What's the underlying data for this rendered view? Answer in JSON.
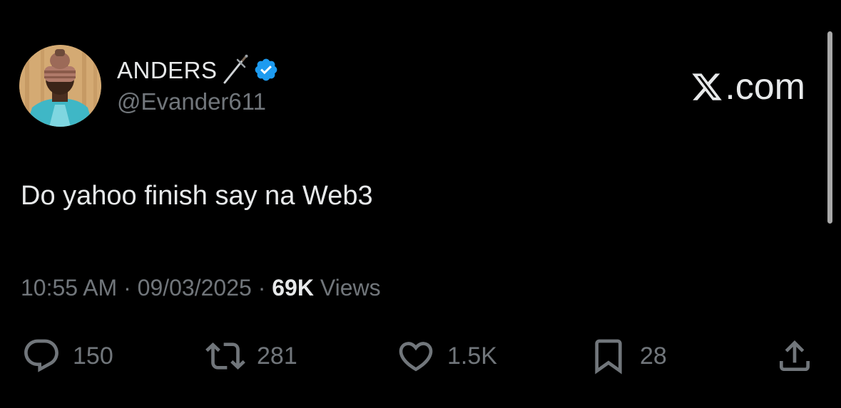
{
  "author": {
    "display_name": "ANDERS",
    "handle": "@Evander611",
    "verified": true,
    "avatar_icon": "profile-photo"
  },
  "brand": {
    "label": ".com"
  },
  "tweet": {
    "text": "Do yahoo finish say na Web3",
    "time": "10:55 AM",
    "separator": "·",
    "date": "09/03/2025",
    "views_count": "69K",
    "views_label": "Views"
  },
  "actions": {
    "replies": "150",
    "reposts": "281",
    "likes": "1.5K",
    "bookmarks": "28"
  },
  "colors": {
    "background": "#000000",
    "primary_text": "#e7e9ea",
    "secondary_text": "#71767b",
    "verified_blue": "#1d9bf0"
  }
}
